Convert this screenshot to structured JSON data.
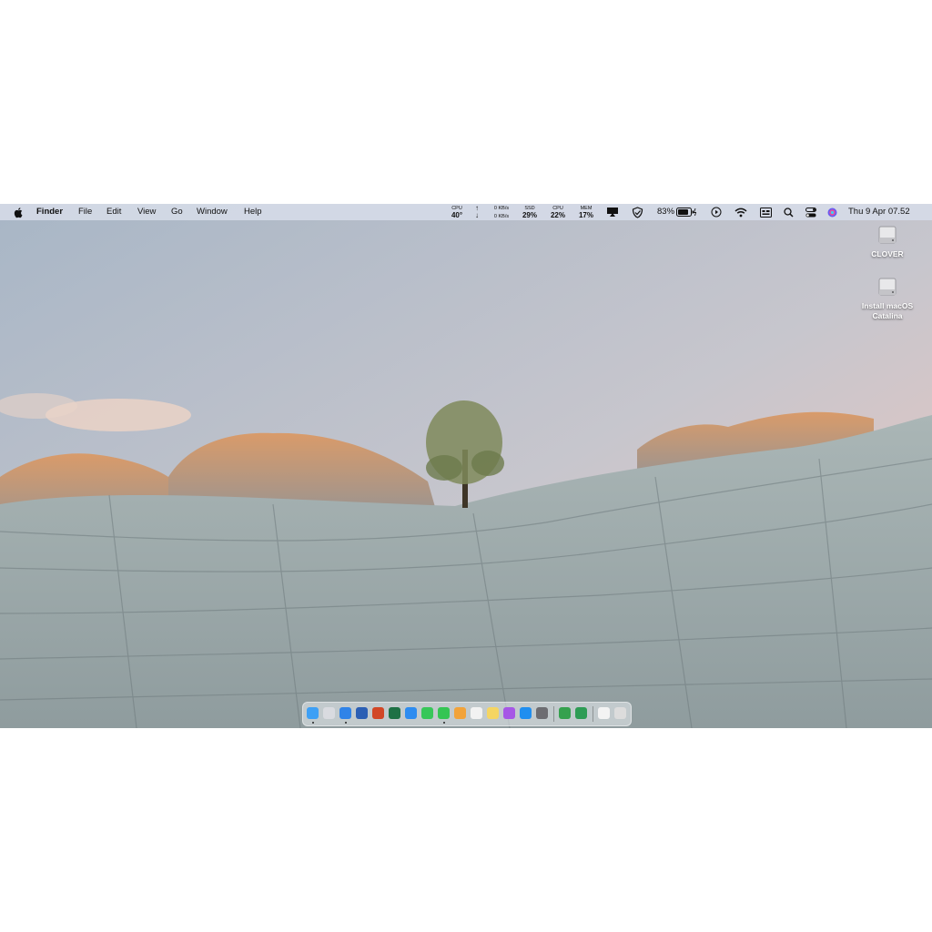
{
  "menubar": {
    "apple_icon": "apple-logo-icon",
    "app_name": "Finder",
    "menus": [
      "File",
      "Edit",
      "View",
      "Go",
      "Window",
      "Help"
    ],
    "stats": {
      "cpu_temp": {
        "label": "CPU",
        "value": "40°"
      },
      "network": {
        "up": "0 KB/s",
        "down": "0 KB/s"
      },
      "ssd": {
        "label": "SSD",
        "value": "29%"
      },
      "cpu_usage": {
        "label": "CPU",
        "value": "22%"
      },
      "mem": {
        "label": "MEM",
        "value": "17%"
      }
    },
    "battery_percent": "83%",
    "clock": "Thu 9 Apr  07.52"
  },
  "desktop_icons": [
    {
      "label": "CLOVER",
      "icon": "drive-icon"
    },
    {
      "label": "Install macOS Catalina",
      "icon": "drive-icon"
    }
  ],
  "dock": {
    "apps": [
      {
        "name": "finder",
        "color": "#3ea0f5",
        "running": true
      },
      {
        "name": "launchpad",
        "color": "#d9dbe0",
        "running": false
      },
      {
        "name": "safari",
        "color": "#2f83e8",
        "running": true
      },
      {
        "name": "word",
        "color": "#2b5fb4",
        "running": false
      },
      {
        "name": "powerpoint",
        "color": "#d24726",
        "running": false
      },
      {
        "name": "excel",
        "color": "#1e7145",
        "running": false
      },
      {
        "name": "mail",
        "color": "#2d8cf0",
        "running": false
      },
      {
        "name": "facetime",
        "color": "#37c759",
        "running": false
      },
      {
        "name": "messages",
        "color": "#35c553",
        "running": true
      },
      {
        "name": "photos",
        "color": "#f2a33a",
        "running": false
      },
      {
        "name": "reminders",
        "color": "#f2f2f2",
        "running": false
      },
      {
        "name": "notes",
        "color": "#f5d563",
        "running": false
      },
      {
        "name": "podcasts",
        "color": "#a657e6",
        "running": false
      },
      {
        "name": "app-store",
        "color": "#1f8ef0",
        "running": false
      },
      {
        "name": "system-preferences",
        "color": "#6d6d72",
        "running": false
      }
    ],
    "extras": [
      {
        "name": "adguard",
        "color": "#35a14e"
      },
      {
        "name": "battery-app",
        "color": "#2e9c55"
      }
    ],
    "trash": [
      {
        "name": "documents-stack",
        "color": "#f3f3f3"
      },
      {
        "name": "trash",
        "color": "#dcdcdc"
      }
    ]
  }
}
